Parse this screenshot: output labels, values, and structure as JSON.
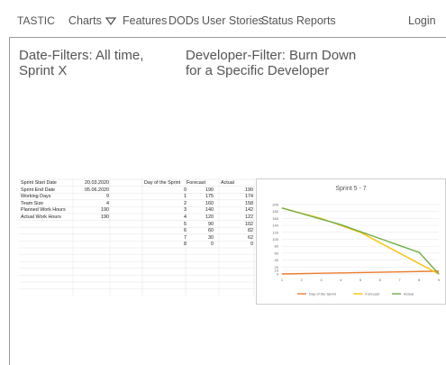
{
  "nav": {
    "brand": "TASTIC",
    "items": [
      "Charts",
      "Features",
      "DODs",
      "User Stories",
      "Status Reports"
    ],
    "login": "Login"
  },
  "filters": {
    "date": "Date-Filters: All time, Sprint X",
    "developer": "Developer-Filter: Burn Down for a Specific Developer"
  },
  "sprint_info": {
    "rows": [
      {
        "label": "Sprint Start Date",
        "value": "20.03.2020"
      },
      {
        "label": "Sprint End Date",
        "value": "05.06.2020"
      },
      {
        "label": "Working Days",
        "value": "9"
      },
      {
        "label": "Team Size",
        "value": "4"
      },
      {
        "label": "Planned Work Hours",
        "value": "190"
      },
      {
        "label": "Actual Work Hours",
        "value": "190"
      }
    ]
  },
  "table": {
    "headers": [
      "Day of the Sprint",
      "Forecast",
      "Actual"
    ],
    "rows": [
      [
        "0",
        "190",
        "190"
      ],
      [
        "1",
        "175",
        "174"
      ],
      [
        "2",
        "160",
        "158"
      ],
      [
        "3",
        "140",
        "142"
      ],
      [
        "4",
        "120",
        "122"
      ],
      [
        "5",
        "90",
        "102"
      ],
      [
        "6",
        "60",
        "82"
      ],
      [
        "7",
        "30",
        "62"
      ],
      [
        "8",
        "0",
        "0"
      ]
    ]
  },
  "chart_data": {
    "type": "line",
    "title": "Sprint 5 - 7",
    "x": [
      1,
      2,
      3,
      4,
      5,
      6,
      7,
      8,
      9
    ],
    "ylim": [
      0,
      200
    ],
    "yticks": [
      0,
      10,
      20,
      40,
      60,
      80,
      100,
      120,
      140,
      160,
      180,
      200
    ],
    "series": [
      {
        "name": "Day of the Sprint",
        "color": "#ed7d31",
        "values": [
          0,
          1,
          2,
          3,
          4,
          5,
          6,
          7,
          8
        ]
      },
      {
        "name": "Forecast",
        "color": "#ffc000",
        "values": [
          190,
          175,
          160,
          140,
          120,
          90,
          60,
          30,
          0
        ]
      },
      {
        "name": "Actual",
        "color": "#70ad47",
        "values": [
          190,
          174,
          158,
          142,
          122,
          102,
          82,
          62,
          0
        ]
      }
    ],
    "legend": "bottom"
  }
}
